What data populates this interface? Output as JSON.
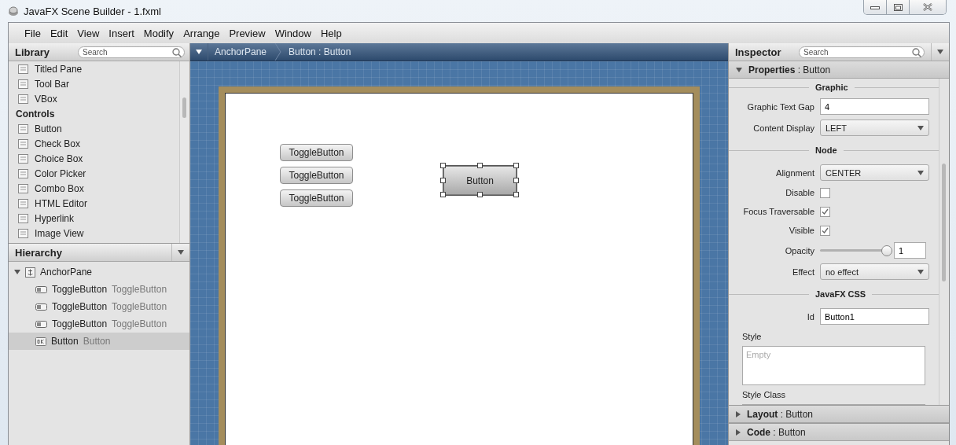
{
  "window": {
    "title": "JavaFX Scene Builder - 1.fxml"
  },
  "menu": [
    "File",
    "Edit",
    "View",
    "Insert",
    "Modify",
    "Arrange",
    "Preview",
    "Window",
    "Help"
  ],
  "library": {
    "title": "Library",
    "search_placeholder": "Search",
    "items": [
      {
        "kind": "item",
        "label": "Titled Pane"
      },
      {
        "kind": "item",
        "label": "Tool Bar"
      },
      {
        "kind": "item",
        "label": "VBox"
      },
      {
        "kind": "section",
        "label": "Controls"
      },
      {
        "kind": "item",
        "label": "Button"
      },
      {
        "kind": "item",
        "label": "Check Box"
      },
      {
        "kind": "item",
        "label": "Choice Box"
      },
      {
        "kind": "item",
        "label": "Color Picker"
      },
      {
        "kind": "item",
        "label": "Combo Box"
      },
      {
        "kind": "item",
        "label": "HTML Editor"
      },
      {
        "kind": "item",
        "label": "Hyperlink"
      },
      {
        "kind": "item",
        "label": "Image View"
      }
    ]
  },
  "hierarchy": {
    "title": "Hierarchy",
    "root": {
      "label": "AnchorPane",
      "expanded": true,
      "children": [
        {
          "kind": "toggle",
          "label": "ToggleButton",
          "type": "ToggleButton",
          "selected": false
        },
        {
          "kind": "toggle",
          "label": "ToggleButton",
          "type": "ToggleButton",
          "selected": false
        },
        {
          "kind": "toggle",
          "label": "ToggleButton",
          "type": "ToggleButton",
          "selected": false
        },
        {
          "kind": "button",
          "label": "Button",
          "type": "Button",
          "selected": true
        }
      ]
    }
  },
  "canvas": {
    "breadcrumb": [
      "AnchorPane",
      "Button : Button"
    ],
    "components": [
      {
        "kind": "toggle",
        "label": "ToggleButton",
        "selected": false
      },
      {
        "kind": "toggle",
        "label": "ToggleButton",
        "selected": false
      },
      {
        "kind": "toggle",
        "label": "ToggleButton",
        "selected": false
      },
      {
        "kind": "button",
        "label": "Button",
        "selected": true
      }
    ]
  },
  "inspector": {
    "title": "Inspector",
    "search_placeholder": "Search",
    "properties": {
      "title": "Properties",
      "subject": ": Button",
      "expanded": true
    },
    "sections": [
      {
        "heading": "Graphic",
        "rows": [
          {
            "kind": "text",
            "label": "Graphic Text Gap",
            "value": "4"
          },
          {
            "kind": "select",
            "label": "Content Display",
            "value": "LEFT"
          }
        ]
      },
      {
        "heading": "Node",
        "rows": [
          {
            "kind": "select",
            "label": "Alignment",
            "value": "CENTER"
          },
          {
            "kind": "checkbox",
            "label": "Disable",
            "checked": false
          },
          {
            "kind": "checkbox",
            "label": "Focus Traversable",
            "checked": true
          },
          {
            "kind": "checkbox",
            "label": "Visible",
            "checked": true
          },
          {
            "kind": "slider",
            "label": "Opacity",
            "level": 1,
            "value": "1"
          },
          {
            "kind": "select",
            "label": "Effect",
            "value": "no effect"
          }
        ]
      },
      {
        "heading": "JavaFX CSS",
        "rows": [
          {
            "kind": "text",
            "label": "Id",
            "value": "Button1"
          },
          {
            "kind": "textarea",
            "label": "Style",
            "placeholder": "Empty"
          },
          {
            "kind": "textarea",
            "label": "Style Class"
          }
        ]
      }
    ],
    "collapsed": [
      {
        "title": "Layout",
        "subject": ": Button",
        "expanded": false
      },
      {
        "title": "Code",
        "subject": ": Button",
        "expanded": false
      }
    ]
  }
}
